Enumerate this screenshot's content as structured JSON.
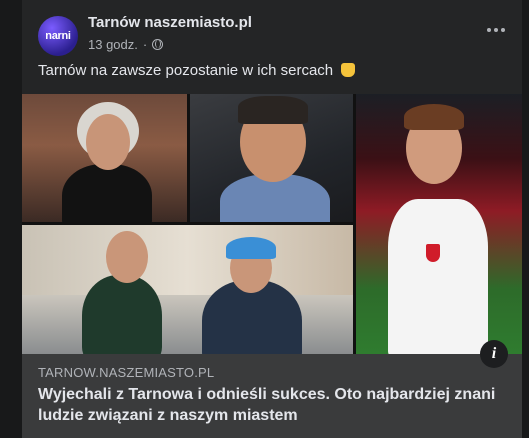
{
  "post": {
    "page_name": "Tarnów naszemiasto.pl",
    "avatar_text": "narni",
    "time": "13 godz.",
    "separator": "·",
    "text": "Tarnów na zawsze pozostanie w ich sercach"
  },
  "link": {
    "domain": "TARNOW.NASZEMIASTO.PL",
    "title": "Wyjechali z Tarnowa i odnieśli sukces. Oto najbardziej znani ludzie związani z naszym miastem"
  },
  "icons": {
    "more": "more-horizontal-icon",
    "privacy": "globe-icon",
    "info": "info-icon",
    "emoji": "pointing-down-emoji"
  },
  "colors": {
    "background": "#18191a",
    "card": "#242526",
    "link_box": "#3a3b3c",
    "avatar": "#4b2fd6"
  }
}
